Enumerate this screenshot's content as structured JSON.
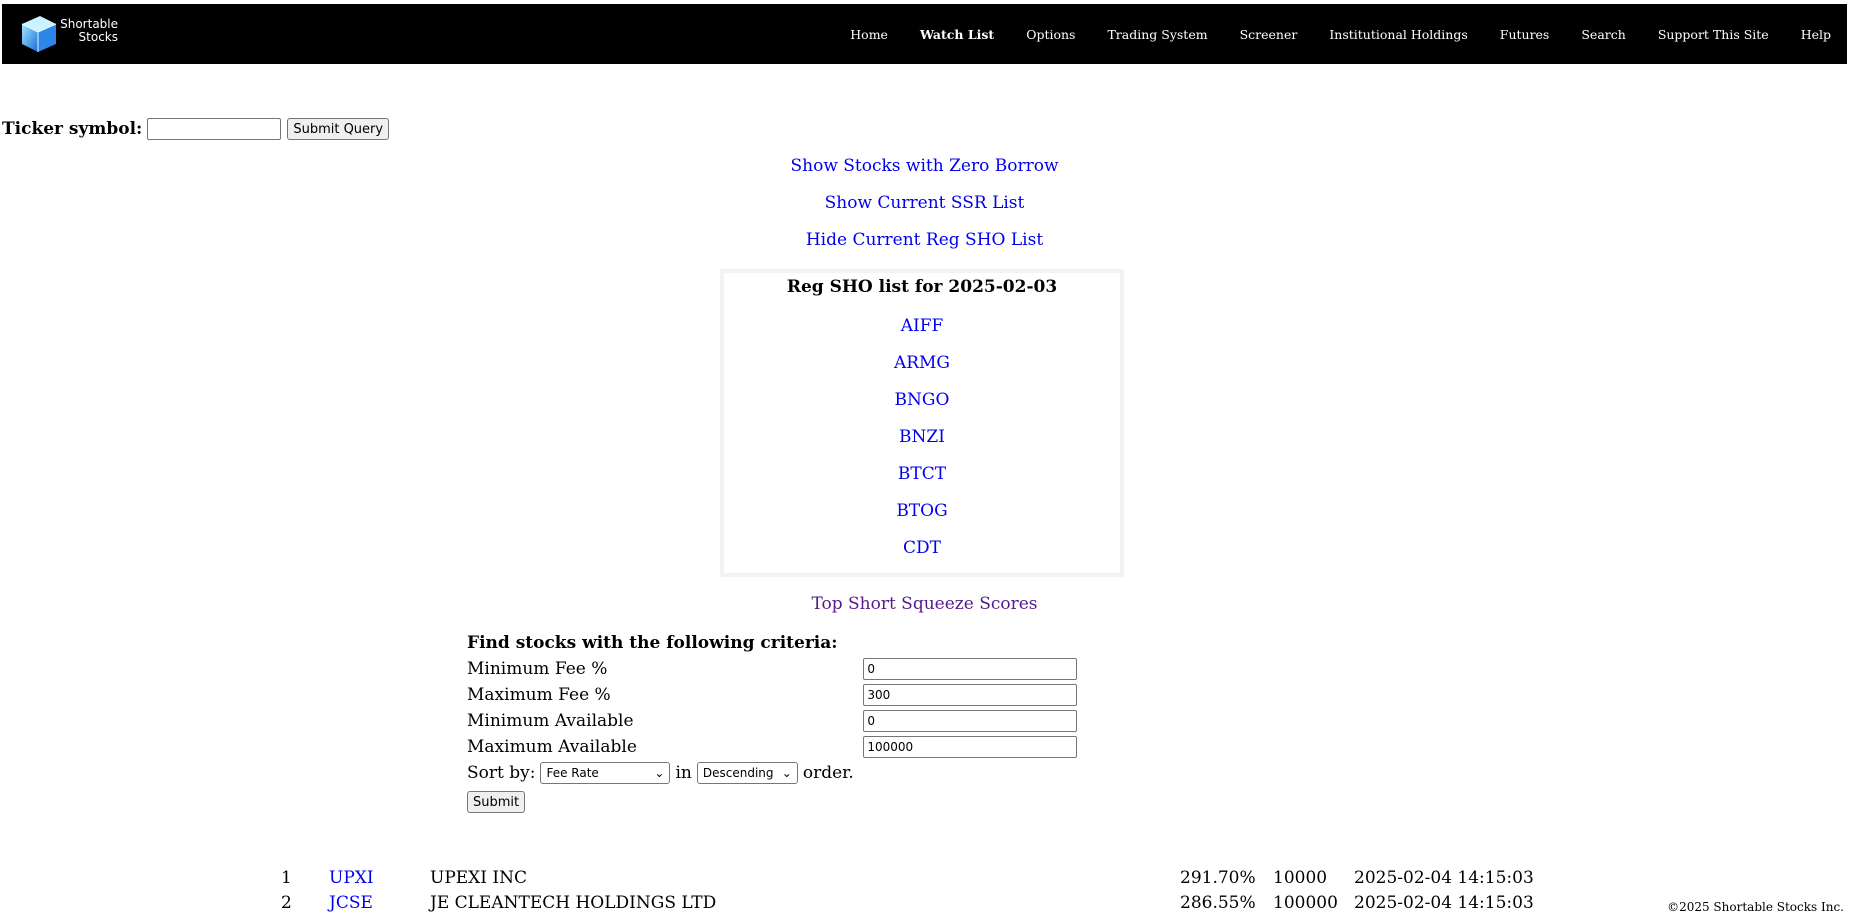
{
  "header": {
    "logo_line1": "Shortable",
    "logo_line2": "Stocks",
    "nav": [
      {
        "label": "Home"
      },
      {
        "label": "Watch List"
      },
      {
        "label": "Options"
      },
      {
        "label": "Trading System"
      },
      {
        "label": "Screener"
      },
      {
        "label": "Institutional Holdings"
      },
      {
        "label": "Futures"
      },
      {
        "label": "Search"
      },
      {
        "label": "Support This Site"
      },
      {
        "label": "Help"
      }
    ],
    "active_nav": "Watch List"
  },
  "ticker": {
    "label": "Ticker symbol:",
    "value": "",
    "button": "Submit Query"
  },
  "links": {
    "zero_borrow": "Show Stocks with Zero Borrow",
    "ssr_list": "Show Current SSR List",
    "reg_sho": "Hide Current Reg SHO List",
    "squeeze": "Top Short Squeeze Scores"
  },
  "reg_sho": {
    "title": "Reg SHO list for 2025-02-03",
    "tickers": [
      "AIFF",
      "ARMG",
      "BNGO",
      "BNZI",
      "BTCT",
      "BTOG",
      "CDT"
    ]
  },
  "criteria": {
    "title": "Find stocks with the following criteria:",
    "min_fee_label": "Minimum Fee %",
    "min_fee_value": "0",
    "max_fee_label": "Maximum Fee %",
    "max_fee_value": "300",
    "min_avail_label": "Minimum Available",
    "min_avail_value": "0",
    "max_avail_label": "Maximum Available",
    "max_avail_value": "100000",
    "sort_label": "Sort by:",
    "sort_value": "Fee Rate",
    "in_label": "in",
    "order_value": "Descending",
    "order_label": "order.",
    "submit": "Submit"
  },
  "results": [
    {
      "rank": "1",
      "symbol": "UPXI",
      "name": "UPEXI INC",
      "fee": "291.70%",
      "available": "10000",
      "time": "2025-02-04 14:15:03"
    },
    {
      "rank": "2",
      "symbol": "JCSE",
      "name": "JE CLEANTECH HOLDINGS LTD",
      "fee": "286.55%",
      "available": "100000",
      "time": "2025-02-04 14:15:03"
    }
  ],
  "footer": {
    "copyright": "©2025 Shortable Stocks Inc."
  },
  "colors": {
    "link": "#0000ee",
    "visited_link": "#551a8b",
    "header_bg": "#000000"
  }
}
